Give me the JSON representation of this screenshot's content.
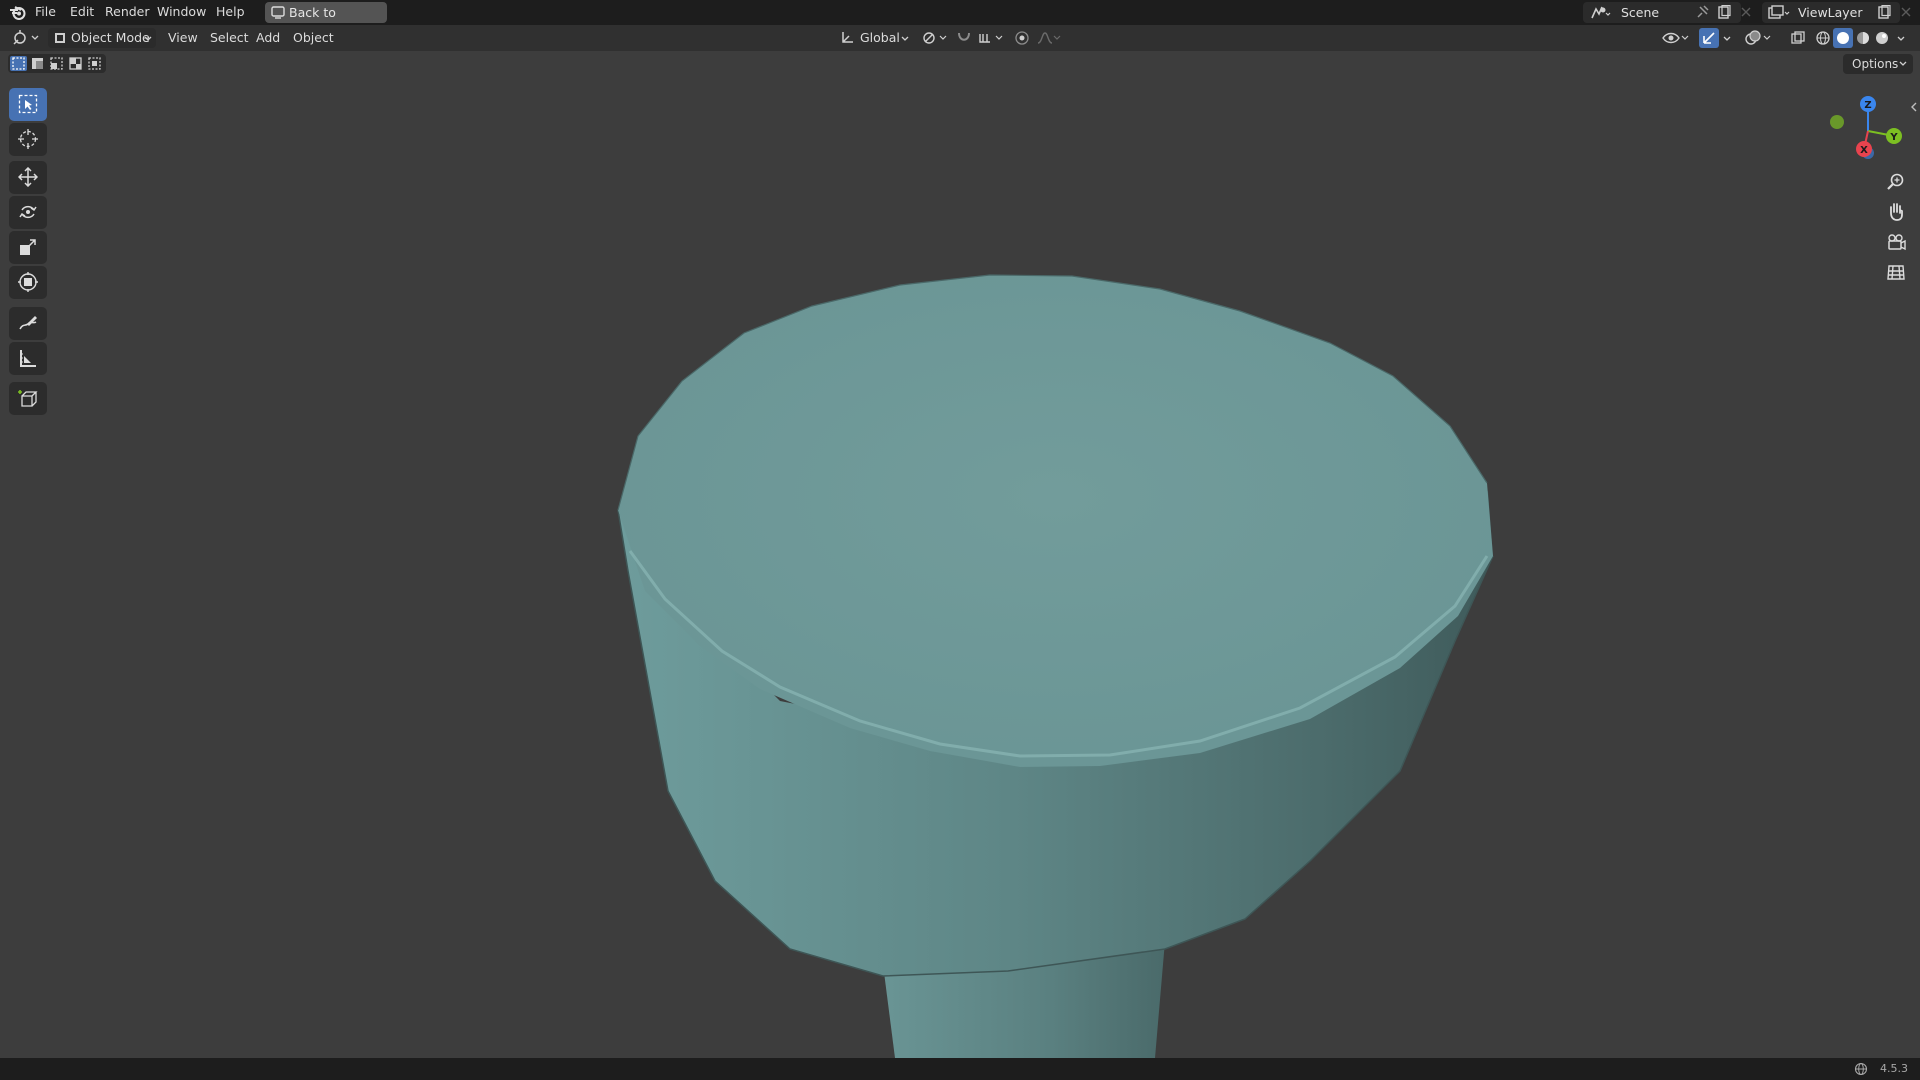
{
  "menu": {
    "file": "File",
    "edit": "Edit",
    "render": "Render",
    "window": "Window",
    "help": "Help",
    "back_to_previous": "Back to Previous"
  },
  "scene": {
    "name": "Scene"
  },
  "view_layer": {
    "name": "ViewLayer"
  },
  "header": {
    "mode": "Object Mode",
    "view": "View",
    "select": "Select",
    "add": "Add",
    "object": "Object",
    "transform_orientation": "Global"
  },
  "viewport": {
    "options_label": "Options",
    "gizmo_axes": {
      "z": "Z",
      "y": "Y",
      "x": "X"
    },
    "mesh_color": "#6f9a99"
  },
  "toolbar": {
    "tools": [
      "select-box",
      "cursor",
      "move",
      "rotate",
      "scale",
      "transform",
      "annotate",
      "measure",
      "add-cube"
    ],
    "active_tool": "select-box"
  },
  "status": {
    "version": "4.5.3"
  },
  "colors": {
    "background": "#3d3d3d",
    "topbar": "#1d1d1d",
    "header": "#303030",
    "accent": "#4772b3",
    "axis_x": "#e8434e",
    "axis_y": "#7cbf22",
    "axis_z": "#3a86ee"
  }
}
